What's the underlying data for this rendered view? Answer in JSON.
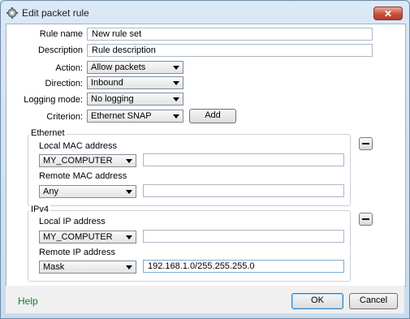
{
  "window": {
    "title": "Edit packet rule",
    "close_glyph": "✕"
  },
  "form": {
    "rule_name": {
      "label": "Rule name",
      "value": "New rule set"
    },
    "description": {
      "label": "Description",
      "value": "Rule description"
    },
    "action": {
      "label": "Action:",
      "value": "Allow packets"
    },
    "direction": {
      "label": "Direction:",
      "value": "Inbound"
    },
    "logging_mode": {
      "label": "Logging mode:",
      "value": "No logging"
    },
    "criterion": {
      "label": "Criterion:",
      "value": "Ethernet SNAP",
      "add_label": "Add"
    }
  },
  "ethernet": {
    "title": "Ethernet",
    "local": {
      "label": "Local MAC address",
      "select": "MY_COMPUTER",
      "value": ""
    },
    "remote": {
      "label": "Remote MAC address",
      "select": "Any",
      "value": ""
    },
    "remove_icon": "minus-icon"
  },
  "ipv4": {
    "title": "IPv4",
    "local": {
      "label": "Local IP address",
      "select": "MY_COMPUTER",
      "value": ""
    },
    "remote": {
      "label": "Remote IP address",
      "select": "Mask",
      "value": "192.168.1.0/255.255.255.0"
    },
    "remove_icon": "minus-icon"
  },
  "footer": {
    "help": "Help",
    "ok": "OK",
    "cancel": "Cancel"
  }
}
